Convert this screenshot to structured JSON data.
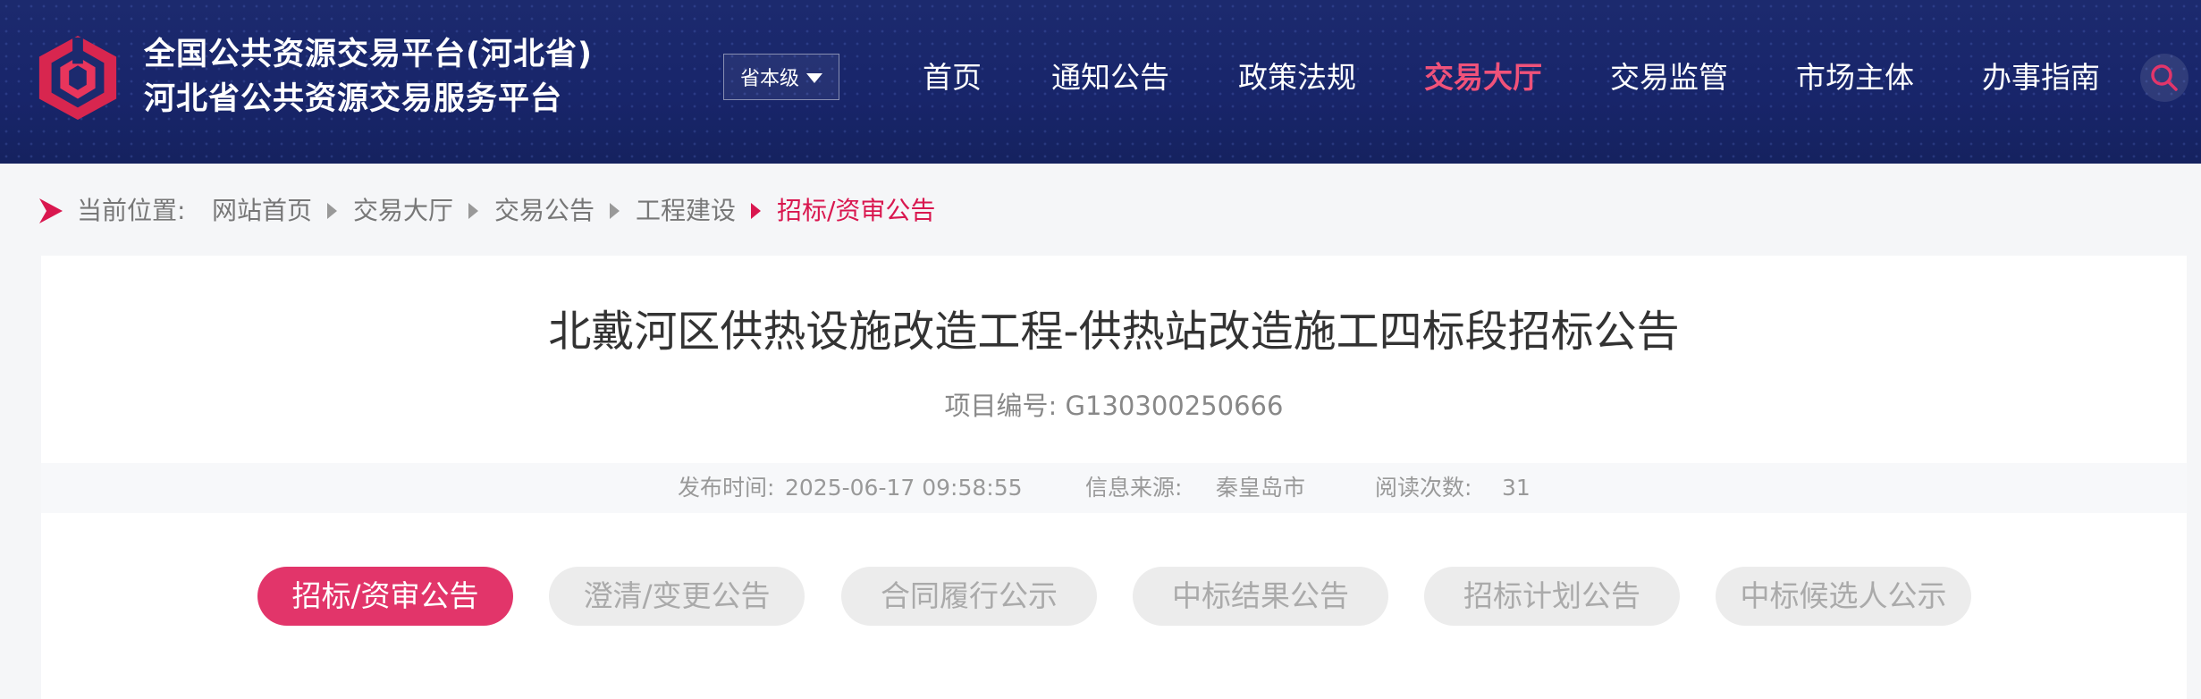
{
  "header": {
    "brand_line1": "全国公共资源交易平台(河北省)",
    "brand_line2": "河北省公共资源交易服务平台",
    "level_select": "省本级",
    "nav": [
      {
        "label": "首页",
        "active": false
      },
      {
        "label": "通知公告",
        "active": false
      },
      {
        "label": "政策法规",
        "active": false
      },
      {
        "label": "交易大厅",
        "active": true
      },
      {
        "label": "交易监管",
        "active": false
      },
      {
        "label": "市场主体",
        "active": false
      },
      {
        "label": "办事指南",
        "active": false
      }
    ],
    "search_icon": "search-icon"
  },
  "breadcrumb": {
    "prefix": "当前位置:",
    "items": [
      "网站首页",
      "交易大厅",
      "交易公告",
      "工程建设"
    ],
    "current": "招标/资审公告"
  },
  "article": {
    "title": "北戴河区供热设施改造工程-供热站改造施工四标段招标公告",
    "project_no_label": "项目编号:",
    "project_no": "G130300250666",
    "publish_label": "发布时间:",
    "publish_time": "2025-06-17 09:58:55",
    "source_label": "信息来源:",
    "source": "秦皇岛市",
    "views_label": "阅读次数:",
    "views": "31"
  },
  "tabs": [
    {
      "label": "招标/资审公告",
      "active": true
    },
    {
      "label": "澄清/变更公告",
      "active": false
    },
    {
      "label": "合同履行公示",
      "active": false
    },
    {
      "label": "中标结果公告",
      "active": false
    },
    {
      "label": "招标计划公告",
      "active": false
    },
    {
      "label": "中标候选人公示",
      "active": false
    }
  ],
  "colors": {
    "header_bg": "#1c2a6e",
    "accent": "#e2356a",
    "nav_active": "#f0527a",
    "breadcrumb_current": "#d9174f"
  }
}
